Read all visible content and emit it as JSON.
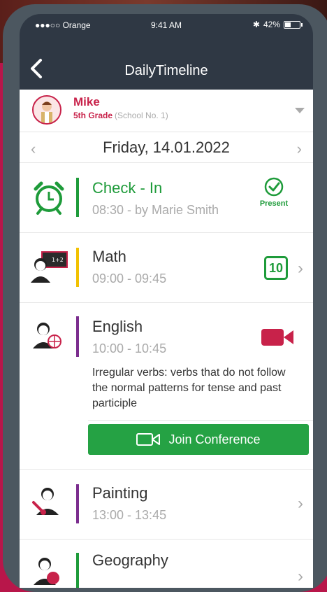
{
  "status_bar": {
    "carrier": "●●●○○ Orange",
    "time": "9:41 AM",
    "battery": "42%",
    "battery_level": 0.42
  },
  "navbar": {
    "title": "DailyTimeline"
  },
  "student": {
    "name": "Mike",
    "grade": "5th Grade",
    "school": "(School No. 1)"
  },
  "date": "Friday, 14.01.2022",
  "timeline": [
    {
      "subject": "Check - In",
      "time": "08:30 - by Marie Smith",
      "status": "Present",
      "bar_color": "#1e9b3a"
    },
    {
      "subject": "Math",
      "time": "09:00 - 09:45",
      "grade": "10",
      "bar_color": "#f2c100"
    },
    {
      "subject": "English",
      "time": "10:00 - 10:45",
      "description": "Irregular verbs: verbs that do not follow the normal patterns for tense and past participle",
      "button": "Join Conference",
      "bar_color": "#7b2d8e"
    },
    {
      "subject": "Painting",
      "time": "13:00 - 13:45",
      "bar_color": "#7b2d8e"
    },
    {
      "subject": "Geography",
      "bar_color": "#1e9b3a"
    }
  ],
  "colors": {
    "accent": "#c8224a",
    "green": "#1e9b3a",
    "camera": "#c8224a"
  }
}
